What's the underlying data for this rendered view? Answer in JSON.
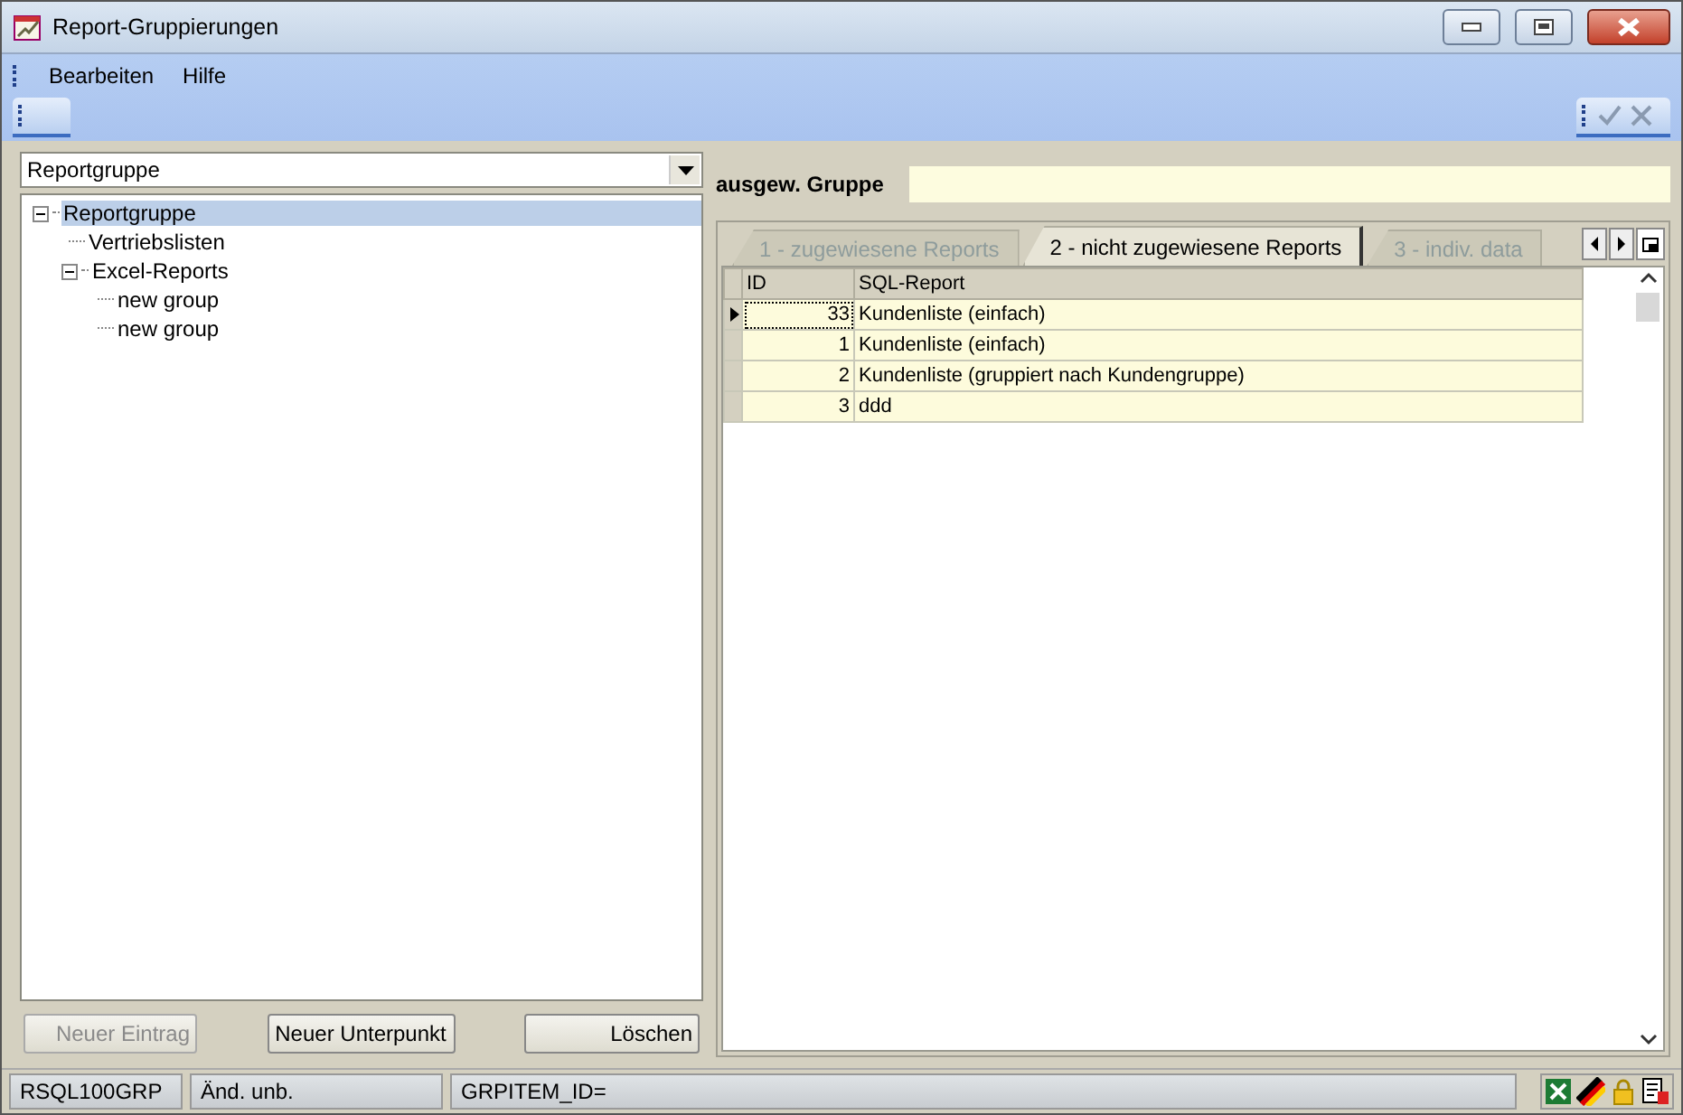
{
  "window": {
    "title": "Report-Gruppierungen"
  },
  "menu": [
    {
      "label": "Bearbeiten"
    },
    {
      "label": "Hilfe"
    }
  ],
  "group_select": {
    "value": "Reportgruppe"
  },
  "tree": [
    {
      "label": "Reportgruppe",
      "selected": true,
      "expanded": true,
      "children": [
        {
          "label": "Vertriebslisten",
          "selected": false
        },
        {
          "label": "Excel-Reports",
          "selected": false,
          "expanded": true,
          "children": [
            {
              "label": "new group",
              "selected": false
            },
            {
              "label": "new group",
              "selected": false
            }
          ]
        }
      ]
    }
  ],
  "buttons": [
    {
      "label": "Neuer Eintrag",
      "disabled": true
    },
    {
      "label": "Neuer Unterpunkt",
      "disabled": false
    },
    {
      "label": "Löschen",
      "disabled": false
    }
  ],
  "selected_group": {
    "label": "ausgew. Gruppe"
  },
  "tabs": [
    {
      "label": "1 - zugewiesene Reports",
      "selected": false,
      "disabled": true
    },
    {
      "label": "2 - nicht zugewiesene Reports",
      "selected": true,
      "disabled": false
    },
    {
      "label": "3 - indiv. data",
      "selected": false,
      "disabled": true
    }
  ],
  "table": {
    "columns": [
      "ID",
      "SQL-Report"
    ],
    "rows": [
      {
        "id": "33",
        "report": "Kundenliste (einfach)",
        "selected": true
      },
      {
        "id": "1",
        "report": "Kundenliste (einfach)",
        "selected": false
      },
      {
        "id": "2",
        "report": "Kundenliste (gruppiert nach Kundengruppe)",
        "selected": false
      },
      {
        "id": "3",
        "report": "ddd",
        "selected": false
      }
    ]
  },
  "status_bar": [
    "RSQL100GRP",
    "Änd. unb.",
    "GRPITEM_ID="
  ]
}
